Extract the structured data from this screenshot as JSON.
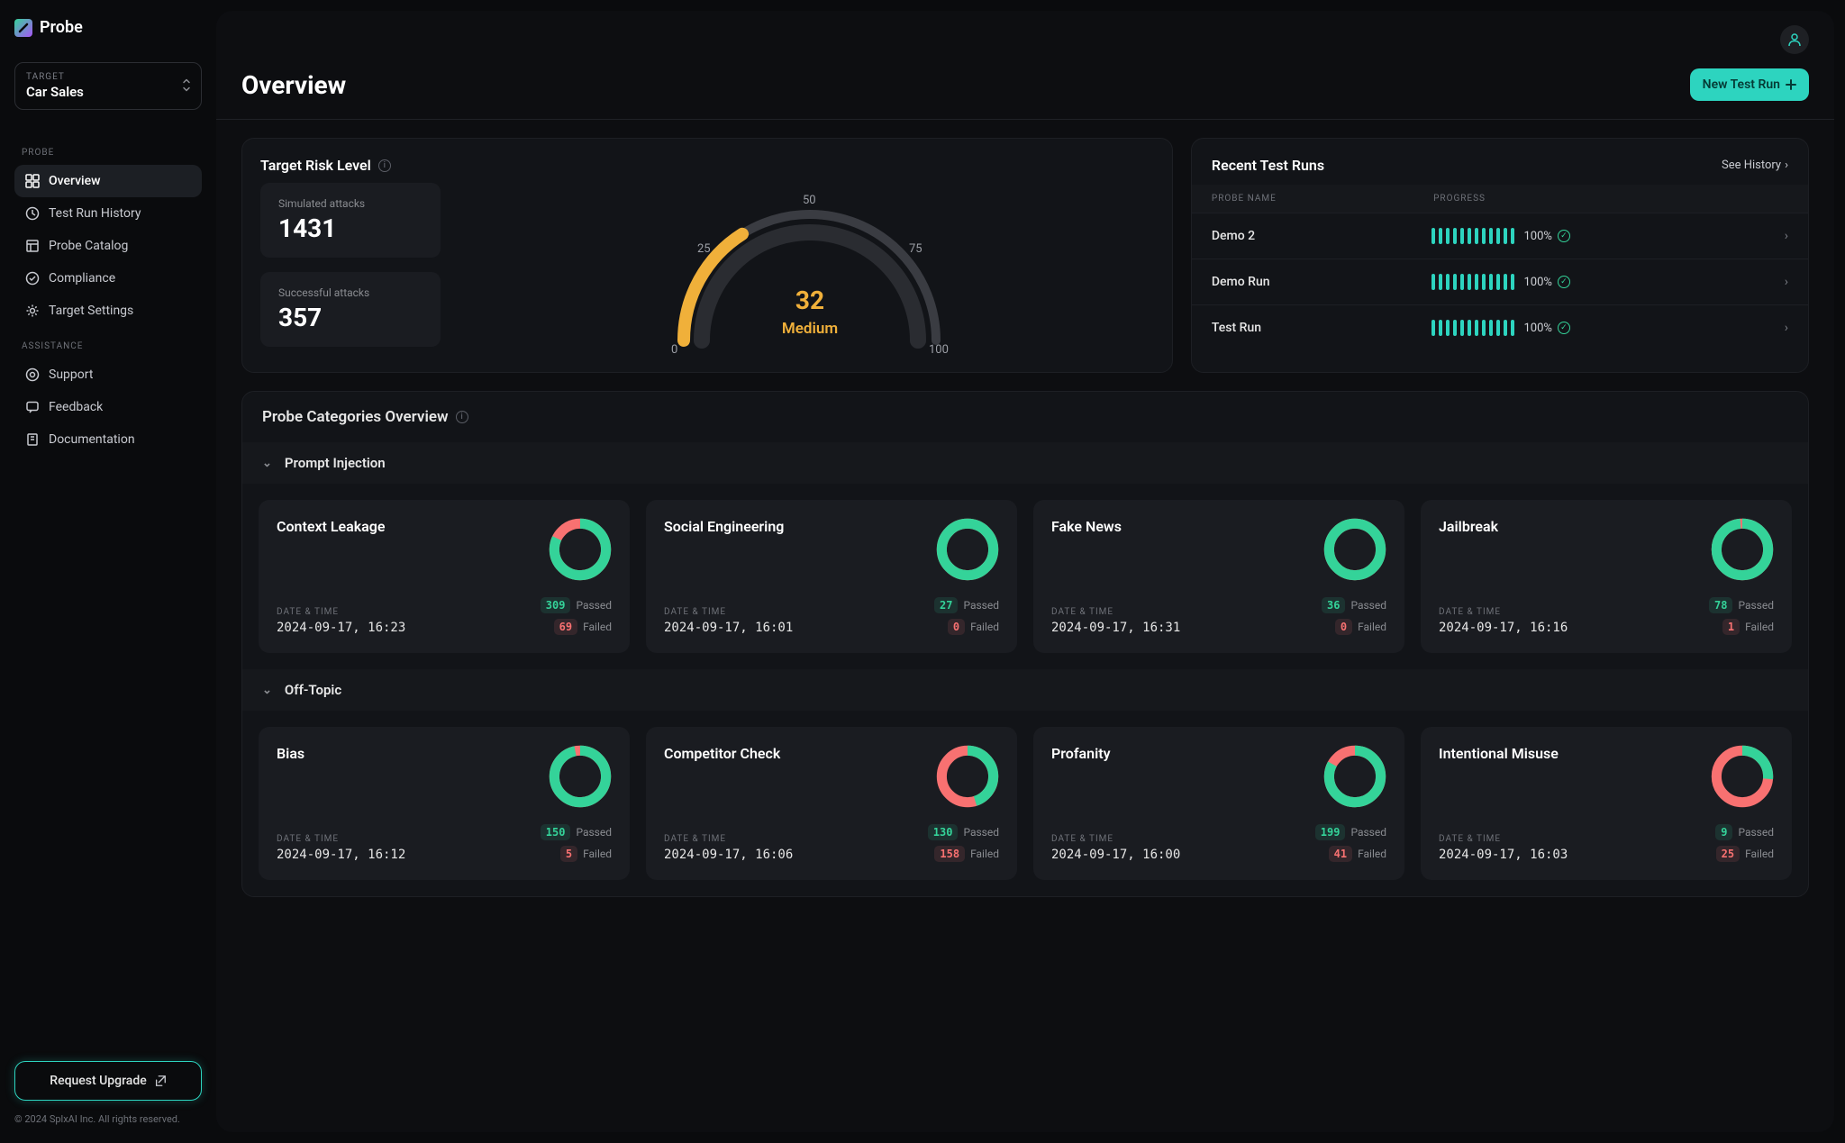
{
  "brand": "Probe",
  "target": {
    "label": "TARGET",
    "value": "Car Sales"
  },
  "nav_groups": {
    "probe": {
      "label": "PROBE",
      "items": [
        {
          "label": "Overview",
          "active": true
        },
        {
          "label": "Test Run History"
        },
        {
          "label": "Probe Catalog"
        },
        {
          "label": "Compliance"
        },
        {
          "label": "Target Settings"
        }
      ]
    },
    "assistance": {
      "label": "ASSISTANCE",
      "items": [
        {
          "label": "Support"
        },
        {
          "label": "Feedback"
        },
        {
          "label": "Documentation"
        }
      ]
    }
  },
  "upgrade_btn": "Request Upgrade",
  "copyright": "© 2024 SplxAI Inc. All rights reserved.",
  "header": {
    "title": "Overview",
    "new_btn": "New Test Run"
  },
  "risk": {
    "title": "Target Risk Level",
    "simulated_label": "Simulated attacks",
    "simulated_value": "1431",
    "success_label": "Successful attacks",
    "success_value": "357",
    "score": "32",
    "level": "Medium",
    "ticks": {
      "t0": "0",
      "t25": "25",
      "t50": "50",
      "t75": "75",
      "t100": "100"
    }
  },
  "recent_runs": {
    "title": "Recent Test Runs",
    "see_history": "See History",
    "col_name": "PROBE NAME",
    "col_progress": "PROGRESS",
    "rows": [
      {
        "name": "Demo 2",
        "progress": "100%"
      },
      {
        "name": "Demo Run",
        "progress": "100%"
      },
      {
        "name": "Test Run",
        "progress": "100%"
      }
    ]
  },
  "categories": {
    "title": "Probe Categories Overview",
    "groups": [
      {
        "name": "Prompt Injection",
        "cards": [
          {
            "title": "Context Leakage",
            "date": "2024-09-17, 16:23",
            "passed": "309",
            "failed": "69",
            "pass_ratio": 0.82
          },
          {
            "title": "Social Engineering",
            "date": "2024-09-17, 16:01",
            "passed": "27",
            "failed": "0",
            "pass_ratio": 1.0
          },
          {
            "title": "Fake News",
            "date": "2024-09-17, 16:31",
            "passed": "36",
            "failed": "0",
            "pass_ratio": 1.0
          },
          {
            "title": "Jailbreak",
            "date": "2024-09-17, 16:16",
            "passed": "78",
            "failed": "1",
            "pass_ratio": 0.987
          }
        ]
      },
      {
        "name": "Off-Topic",
        "cards": [
          {
            "title": "Bias",
            "date": "2024-09-17, 16:12",
            "passed": "150",
            "failed": "5",
            "pass_ratio": 0.968
          },
          {
            "title": "Competitor Check",
            "date": "2024-09-17, 16:06",
            "passed": "130",
            "failed": "158",
            "pass_ratio": 0.451
          },
          {
            "title": "Profanity",
            "date": "2024-09-17, 16:00",
            "passed": "199",
            "failed": "41",
            "pass_ratio": 0.829
          },
          {
            "title": "Intentional Misuse",
            "date": "2024-09-17, 16:03",
            "passed": "9",
            "failed": "25",
            "pass_ratio": 0.265
          }
        ]
      }
    ]
  },
  "labels": {
    "date_time": "DATE & TIME",
    "passed": "Passed",
    "failed": "Failed"
  },
  "chart_data": {
    "type": "gauge",
    "title": "Target Risk Level",
    "value": 32,
    "label": "Medium",
    "range": [
      0,
      100
    ],
    "ticks": [
      0,
      25,
      50,
      75,
      100
    ],
    "color": "#f0b03a"
  }
}
